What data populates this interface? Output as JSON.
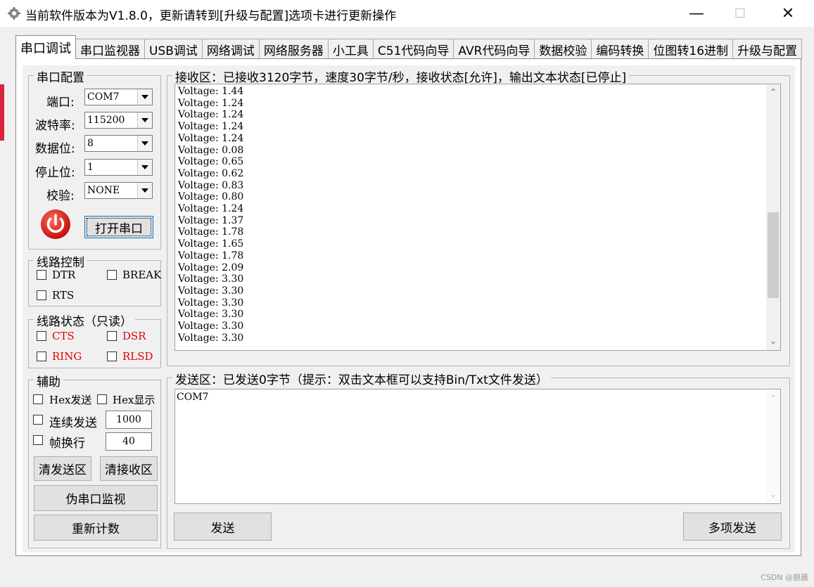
{
  "window": {
    "title": "当前软件版本为V1.8.0，更新请转到[升级与配置]选项卡进行更新操作",
    "minimize": "—",
    "maximize": "☐",
    "close": "✕"
  },
  "tabs": [
    "串口调试",
    "串口监视器",
    "USB调试",
    "网络调试",
    "网络服务器",
    "小工具",
    "C51代码向导",
    "AVR代码向导",
    "数据校验",
    "编码转换",
    "位图转16进制",
    "升级与配置"
  ],
  "serial_config": {
    "title": "串口配置",
    "port_label": "端口:",
    "port_value": "COM7",
    "baud_label": "波特率:",
    "baud_value": "115200",
    "databits_label": "数据位:",
    "databits_value": "8",
    "stopbits_label": "停止位:",
    "stopbits_value": "1",
    "parity_label": "校验:",
    "parity_value": "NONE",
    "open_button": "打开串口"
  },
  "line_control": {
    "title": "线路控制",
    "dtr": "DTR",
    "break": "BREAK",
    "rts": "RTS"
  },
  "line_status": {
    "title": "线路状态（只读）",
    "cts": "CTS",
    "dsr": "DSR",
    "ring": "RING",
    "rlsd": "RLSD"
  },
  "assist": {
    "title": "辅助",
    "hex_send": "Hex发送",
    "hex_show": "Hex显示",
    "continuous_send": "连续发送",
    "continuous_value": "1000",
    "frame_newline": "帧换行",
    "frame_value": "40",
    "clear_send": "清发送区",
    "clear_receive": "清接收区",
    "fake_monitor": "伪串口监视",
    "recount": "重新计数"
  },
  "receive": {
    "title": "接收区：已接收3120字节，速度30字节/秒，接收状态[允许]，输出文本状态[已停止]",
    "lines": [
      "Voltage: 1.44",
      "Voltage: 1.24",
      "Voltage: 1.24",
      "Voltage: 1.24",
      "Voltage: 1.24",
      "Voltage: 0.08",
      "Voltage: 0.65",
      "Voltage: 0.62",
      "Voltage: 0.83",
      "Voltage: 0.80",
      "Voltage: 1.24",
      "Voltage: 1.37",
      "Voltage: 1.78",
      "Voltage: 1.65",
      "Voltage: 1.78",
      "Voltage: 2.09",
      "Voltage: 3.30",
      "Voltage: 3.30",
      "Voltage: 3.30",
      "Voltage: 3.30",
      "Voltage: 3.30",
      "Voltage: 3.30"
    ]
  },
  "send": {
    "title": "发送区：已发送0字节（提示：双击文本框可以支持Bin/Txt文件发送）",
    "text": "COM7",
    "send_button": "发送",
    "multi_send_button": "多项发送"
  },
  "watermark": "CSDN @貌晨",
  "colors": {
    "status_red": "#e60000",
    "power_icon": "#e02020",
    "accent": "#0078d7"
  }
}
